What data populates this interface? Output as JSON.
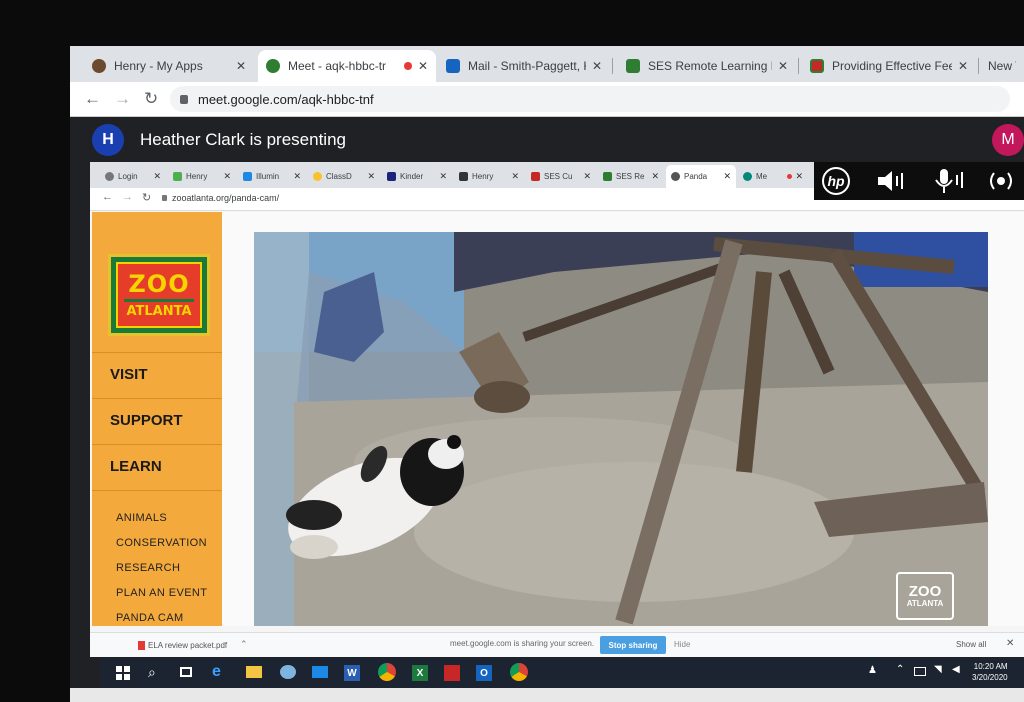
{
  "outer_tabs": [
    {
      "label": "Henry - My Apps",
      "icon": "avatar-icon"
    },
    {
      "label": "Meet - aqk-hbbc-tr",
      "icon": "meet-icon"
    },
    {
      "label": "Mail - Smith-Paggett, K",
      "icon": "outlook-icon"
    },
    {
      "label": "SES Remote Learning Lo",
      "icon": "classroom-icon"
    },
    {
      "label": "Providing Effective Feec",
      "icon": "docs-icon"
    },
    {
      "label": "New Ta",
      "icon": ""
    }
  ],
  "outer_address": {
    "url": "meet.google.com/aqk-hbbc-tnf"
  },
  "meet": {
    "presenter_initial": "H",
    "presenting_text": "Heather Clark is presenting",
    "user_initial": "M"
  },
  "inner_tabs": [
    {
      "label": "Login"
    },
    {
      "label": "Henry"
    },
    {
      "label": "Illumin"
    },
    {
      "label": "ClassD"
    },
    {
      "label": "Kinder"
    },
    {
      "label": "Henry"
    },
    {
      "label": "SES Cu"
    },
    {
      "label": "SES Re"
    },
    {
      "label": "Panda"
    },
    {
      "label": "Me"
    }
  ],
  "inner_address": {
    "url": "zooatlanta.org/panda-cam/"
  },
  "hp": {
    "logo": "hp"
  },
  "zoo": {
    "logo_line1": "ZOO",
    "logo_line2": "ATLANTA",
    "main_nav": [
      "VISIT",
      "SUPPORT",
      "LEARN"
    ],
    "sub_nav": [
      "ANIMALS",
      "CONSERVATION",
      "RESEARCH",
      "PLAN AN EVENT",
      "PANDA CAM"
    ],
    "watermark_line1": "ZOO",
    "watermark_line2": "ATLANTA"
  },
  "download_bar": {
    "file": "ELA review packet.pdf",
    "sharing_text": "meet.google.com is sharing your screen.",
    "stop_label": "Stop sharing",
    "hide_label": "Hide",
    "show_all_label": "Show all"
  },
  "taskbar": {
    "time": "10:20 AM",
    "date": "3/20/2020"
  },
  "colors": {
    "sidebar": "#f3a93b",
    "meet_bg": "#202124",
    "stop_button": "#4a9fe0",
    "taskbar": "#1b2430"
  }
}
